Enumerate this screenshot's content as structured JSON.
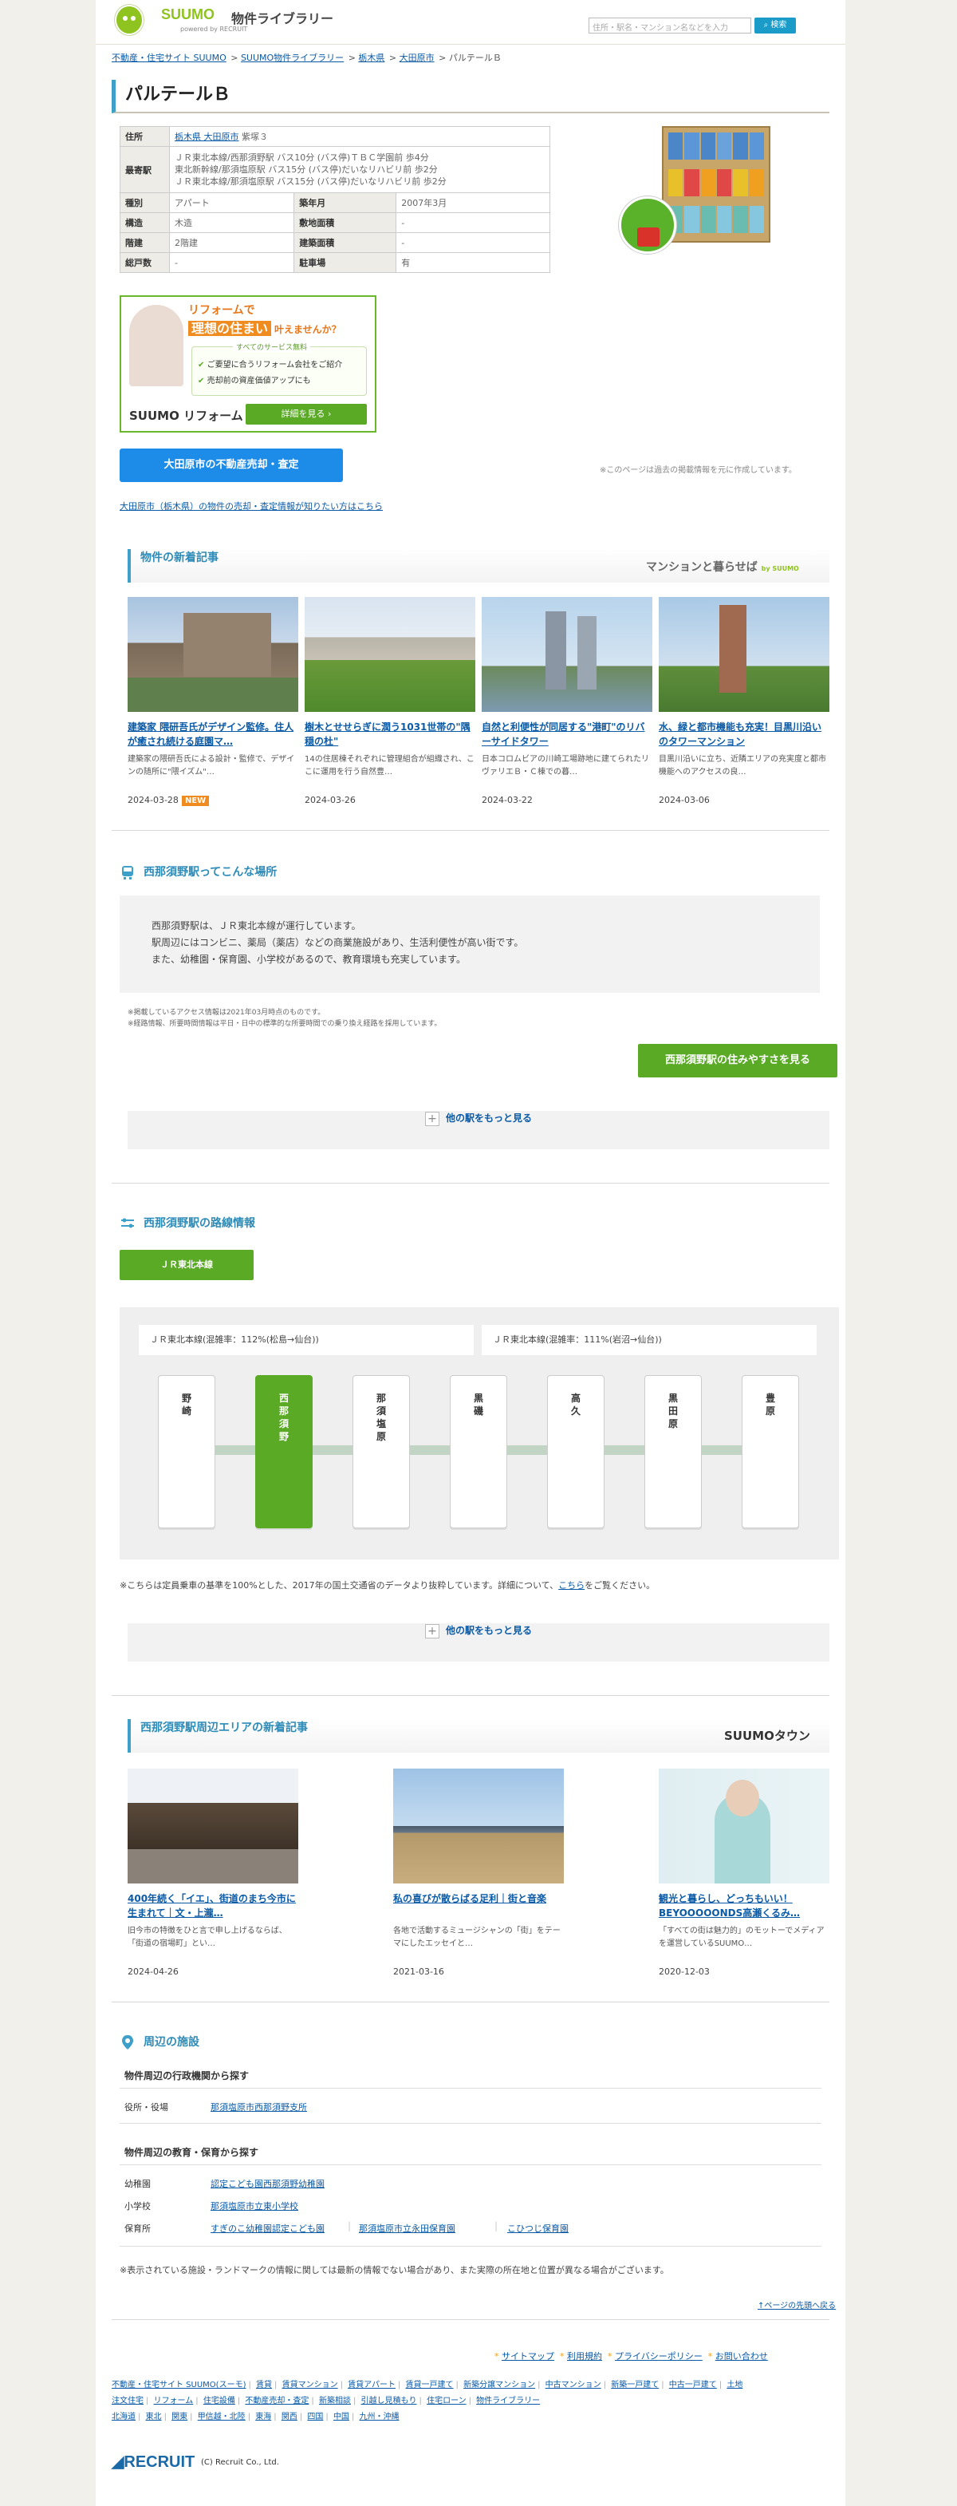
{
  "header": {
    "brand": "SUUMO",
    "site_name": "物件ライブラリー",
    "powered_by": "powered by RECRUIT",
    "search_placeholder": "住所・駅名・マンション名などを入力",
    "search_button": "検索"
  },
  "breadcrumb": [
    {
      "label": "不動産・住宅サイト SUUMO",
      "link": true
    },
    {
      "label": "SUUMO物件ライブラリー",
      "link": true
    },
    {
      "label": "栃木県",
      "link": true
    },
    {
      "label": "大田原市",
      "link": true
    },
    {
      "label": "パルテールＢ",
      "link": false
    }
  ],
  "breadcrumb_sep": ">",
  "property": {
    "name": "パルテールＢ",
    "address_label": "住所",
    "address_link": "栃木県 大田原市",
    "address_rest": " 紫塚３",
    "station_label": "最寄駅",
    "stations": [
      "ＪＲ東北本線/西那須野駅 バス10分 (バス停)ＴＢＣ学園前 歩4分",
      "東北新幹線/那須塩原駅 バス15分 (バス停)だいなリハビリ前 歩2分",
      "ＪＲ東北本線/那須塩原駅 バス15分 (バス停)だいなリハビリ前 歩2分"
    ],
    "rows": [
      {
        "l1": "種別",
        "v1": "アパート",
        "l2": "築年月",
        "v2": "2007年3月"
      },
      {
        "l1": "構造",
        "v1": "木造",
        "l2": "敷地面積",
        "v2": "-"
      },
      {
        "l1": "階建",
        "v1": "2階建",
        "l2": "建築面積",
        "v2": "-"
      },
      {
        "l1": "総戸数",
        "v1": "-",
        "l2": "駐車場",
        "v2": "有"
      }
    ]
  },
  "reform_banner": {
    "line1": "リフォームで",
    "line2_highlight": "理想の住まい",
    "line2_rest": "叶えませんか？",
    "free_badge": "すべてのサービス無料",
    "check1": "ご要望に合うリフォーム会社をご紹介",
    "check2": "売却前の資産価値アップにも",
    "brand": "SUUMO リフォーム",
    "button": "詳細を見る"
  },
  "sell_button": "大田原市の不動産売却・査定",
  "sell_note": "※このページは過去の掲載情報を元に作成しています。",
  "sell_link": "大田原市（栃木県）の物件の売却・査定情報が知りたい方はこちら",
  "articles_section": {
    "title": "物件の新着記事",
    "brand": "マンションと暮らせば",
    "brand_by": "by SUUMO",
    "cards": [
      {
        "title": "建築家 隈研吾氏がデザイン監修。住人が癒され続ける庭園マ…",
        "desc": "建築家の隈研吾氏による設計・監修で、デザインの随所に\"隈イズム\"…",
        "date": "2024-03-28",
        "new": "NEW"
      },
      {
        "title": "樹木とせせらぎに潤う1031世帯の\"隅穏の杜\"",
        "desc": "14の住居棟それぞれに管理組合が組織され、ここに運用を行う自然豊…",
        "date": "2024-03-26"
      },
      {
        "title": "自然と利便性が同居する\"港町\"のリバーサイドタワー",
        "desc": "日本コロムビアの川崎工場跡地に建てられたリヴァリエＢ・Ｃ棟での暮…",
        "date": "2024-03-22"
      },
      {
        "title": "水、緑と都市機能も充実！目黒川沿いのタワーマンション",
        "desc": "目黒川沿いに立ち、近隣エリアの充実度と都市機能へのアクセスの良…",
        "date": "2024-03-06"
      }
    ]
  },
  "station_section": {
    "title": "西那須野駅ってこんな場所",
    "lines": [
      "西那須野駅は、ＪＲ東北本線が運行しています。",
      "駅周辺にはコンビニ、薬局（薬店）などの商業施設があり、生活利便性が高い街です。",
      "また、幼稚園・保育園、小学校があるので、教育環境も充実しています。"
    ],
    "note1": "※掲載しているアクセス情報は2021年03月時点のものです。",
    "note2": "※経路情報、所要時間情報は平日・日中の標準的な所要時間での乗り換え経路を採用しています。",
    "livability_button": "西那須野駅の住みやすさを見る",
    "more": "他の駅をもっと見る"
  },
  "route_section": {
    "title": "西那須野駅の路線情報",
    "line_tab": "ＪＲ東北本線",
    "label_left": "ＪＲ東北本線(混雑率：112%(松島→仙台))",
    "label_right": "ＪＲ東北本線(混雑率：111%(岩沼→仙台))",
    "stations": [
      "野崎",
      "西那須野",
      "那須塩原",
      "黒磯",
      "高久",
      "黒田原",
      "豊原"
    ],
    "current_station_index": 1,
    "note_pre": "※こちらは定員乗車の基準を100%とした、2017年の国土交通省のデータより抜粋しています。詳細について、",
    "note_link": "こちら",
    "note_post": "をご覧ください。",
    "more": "他の駅をもっと見る"
  },
  "area_section": {
    "title": "西那須野駅周辺エリアの新着記事",
    "brand": "SUUMOタウン",
    "cards": [
      {
        "title": "400年続く「イエ」、街道のまち今市に生まれて｜文・上瀧…",
        "desc": "旧今市の特徴をひと言で申し上げるならば、「街道の宿場町」とい…",
        "date": "2024-04-26"
      },
      {
        "title": "私の喜びが散らばる足利｜街と音楽",
        "desc": "各地で活動するミュージシャンの「街」をテーマにしたエッセイと…",
        "date": "2021-03-16"
      },
      {
        "title": "観光と暮らし、どっちもいい！BEYOOOOONDS高瀬くるみ…",
        "desc": "「すべての街は魅力的」のモットーでメディアを運営しているSUUMO…",
        "date": "2020-12-03"
      }
    ]
  },
  "facilities": {
    "title": "周辺の施設",
    "gov_heading": "物件周辺の行政機関から探す",
    "gov_label": "役所・役場",
    "gov_value": "那須塩原市西那須野支所",
    "edu_heading": "物件周辺の教育・保育から探す",
    "kinder_label": "幼稚園",
    "kinder_value": "認定こども園西那須野幼稚園",
    "school_label": "小学校",
    "school_value": "那須塩原市立東小学校",
    "nursery_label": "保育所",
    "nursery_values": [
      "すぎのこ幼稚園認定こども園",
      "那須塩原市立永田保育園",
      "こひつじ保育園"
    ],
    "note": "※表示されている施設・ランドマークの情報に関しては最新の情報でない場合があり、また実際の所在地と位置が異なる場合がございます。",
    "to_top": "↑ページの先頭へ戻る"
  },
  "footer": {
    "main_links": [
      "サイトマップ",
      "利用規約",
      "プライバシーポリシー",
      "お問い合わせ"
    ],
    "row1": [
      "不動産・住宅サイト SUUMO(スーモ)",
      "賃貸",
      "賃貸マンション",
      "賃貸アパート",
      "賃貸一戸建て",
      "新築分譲マンション",
      "中古マンション",
      "新築一戸建て",
      "中古一戸建て",
      "土地"
    ],
    "row2": [
      "注文住宅",
      "リフォーム",
      "住宅設備",
      "不動産売却・査定",
      "新築相談",
      "引越し見積もり",
      "住宅ローン",
      "物件ライブラリー"
    ],
    "row3": [
      "北海道",
      "東北",
      "関東",
      "甲信越・北陸",
      "東海",
      "関西",
      "四国",
      "中国",
      "九州・沖縄"
    ],
    "company": "RECRUIT",
    "copyright": "(C) Recruit Co., Ltd."
  }
}
